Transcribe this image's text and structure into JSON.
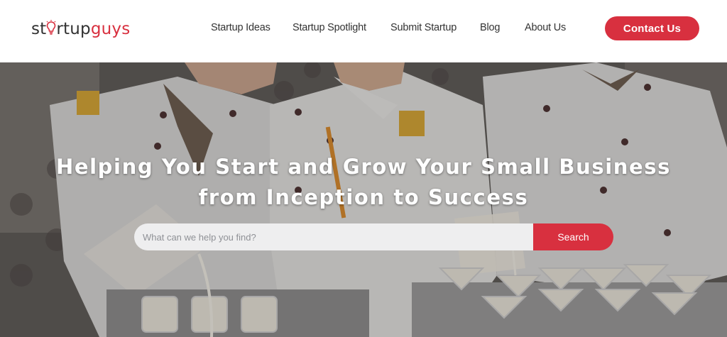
{
  "logo": {
    "part_a": "st",
    "part_a2": "rtup",
    "part_b": "guys"
  },
  "nav": {
    "items": [
      {
        "label": "Startup Ideas"
      },
      {
        "label": "Startup Spotlight"
      },
      {
        "label": "Submit Startup"
      },
      {
        "label": "Blog"
      },
      {
        "label": "About Us"
      }
    ]
  },
  "contact": {
    "label": "Contact Us"
  },
  "hero": {
    "title_line1": "Helping You Start and Grow Your Small Business",
    "title_line2": "from Inception to Success",
    "search_placeholder": "What can we help you find?",
    "search_button": "Search"
  },
  "colors": {
    "accent": "#d8303f",
    "text_dark": "#333333",
    "search_bg": "#eeeeef"
  },
  "icons": {
    "logo_bulb": "lightbulb-icon"
  }
}
